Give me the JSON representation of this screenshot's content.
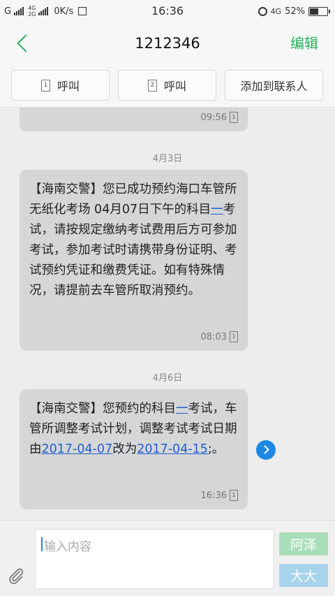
{
  "status_bar": {
    "carrier1": "G",
    "net_label_top": "4G",
    "net_label_bottom": "2G",
    "speed": "0K/s",
    "time": "16:36",
    "net_right": "4G",
    "battery": "52%",
    "battery_level": 0.52
  },
  "header": {
    "title": "1212346",
    "edit_label": "编辑"
  },
  "actions": {
    "call1_sim": "1",
    "call1_label": "呼叫",
    "call2_sim": "2",
    "call2_label": "呼叫",
    "add_contact_label": "添加到联系人"
  },
  "messages": {
    "prev": {
      "time": "09:56",
      "sim": "1"
    },
    "date1": "4月3日",
    "m1": {
      "p1": "【海南交警】您已成功预约海口车管所无纸化考场 04月07日下午的科目",
      "link": "一",
      "p2": "考试，请按规定缴纳考试费用后方可参加考试，参加考试时请携带身份证明、考试预约凭证和缴费凭证。如有特殊情况，请提前去车管所取消预约。",
      "time": "08:03",
      "sim": "1"
    },
    "date2": "4月6日",
    "m2": {
      "p1": "【海南交警】您预约的科目",
      "link1": "一",
      "p2": "考试，车管所调整考试计划，调整考试考试日期由",
      "link2": "2017-04-07",
      "p3": "改为",
      "link3": "2017-04-15",
      "p4": ";。",
      "time": "16:36",
      "sim": "1"
    }
  },
  "composer": {
    "placeholder": "输入内容",
    "send_btn_top": "阿泽",
    "send_btn_bottom": "大大"
  },
  "colors": {
    "accent_green": "#26b35a",
    "bubble": "#d4d6d8",
    "send_green": "#a8dfb8",
    "send_blue": "#a7d3ec"
  }
}
